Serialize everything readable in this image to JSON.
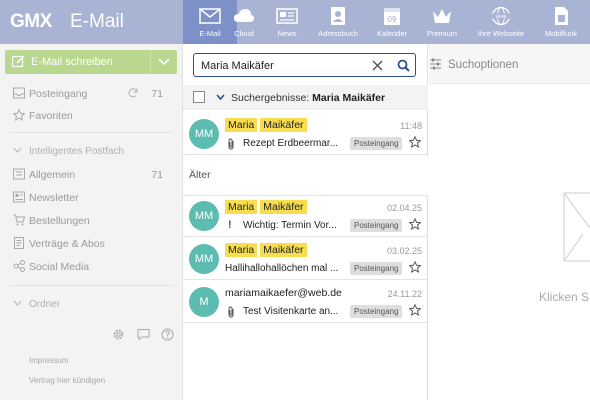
{
  "header": {
    "logo": "GMX",
    "title": "E-Mail",
    "tabs": [
      {
        "label": "E-Mail",
        "icon": "mail-icon"
      },
      {
        "label": "Cloud",
        "icon": "cloud-icon"
      },
      {
        "label": "News",
        "icon": "news-icon"
      },
      {
        "label": "Adressbuch",
        "icon": "addressbook-icon"
      },
      {
        "label": "Kalender",
        "icon": "calendar-icon"
      },
      {
        "label": "Premium",
        "icon": "crown-icon"
      },
      {
        "label": "Ihre Webseite",
        "icon": "globe-icon"
      },
      {
        "label": "Mobilfunk",
        "icon": "sim-icon"
      }
    ],
    "calendar_day": "09",
    "www_text": "www"
  },
  "sidebar": {
    "compose_label": "E-Mail schreiben",
    "inbox": {
      "label": "Posteingang",
      "count": "71"
    },
    "favorites": {
      "label": "Favoriten"
    },
    "smart_header": "Intelligentes Postfach",
    "smart_items": [
      {
        "label": "Allgemein",
        "count": "71",
        "icon": "inbox-icon"
      },
      {
        "label": "Newsletter",
        "icon": "newsletter-icon"
      },
      {
        "label": "Bestellungen",
        "icon": "cart-icon"
      },
      {
        "label": "Verträge & Abos",
        "icon": "contract-icon"
      },
      {
        "label": "Social Media",
        "icon": "social-icon"
      }
    ],
    "folders_header": "Ordner",
    "footer_links": [
      "Impressum",
      "Vertrag hier kündigen"
    ]
  },
  "search": {
    "value": "Maria Maikäfer"
  },
  "results": {
    "prefix": "Suchergebnisse:",
    "query": "Maria Maikäfer"
  },
  "mails": [
    {
      "avatar": "MM",
      "from_hl": [
        "Maria",
        "Maikäfer"
      ],
      "from_text": "",
      "date": "11:48",
      "indicator": "paperclip",
      "subject": "Rezept Erdbeermar...",
      "folder": "Posteingang"
    },
    {
      "avatar": "MM",
      "from_hl": [
        "Maria",
        "Maikäfer"
      ],
      "from_text": "",
      "date": "02.04.25",
      "indicator": "!",
      "subject": "Wichtig: Termin Vor...",
      "folder": "Posteingang"
    },
    {
      "avatar": "MM",
      "from_hl": [
        "Maria",
        "Maikäfer"
      ],
      "from_text": "",
      "date": "03.02.25",
      "indicator": "",
      "subject": "Hallihallohallöchen mal ...",
      "folder": "Posteingang"
    },
    {
      "avatar": "M",
      "from_hl": [],
      "from_text": "mariamaikaefer@web.de",
      "date": "24.11.22",
      "indicator": "paperclip",
      "subject": "Test Visitenkarte an...",
      "folder": "Posteingang"
    }
  ],
  "older_label": "Älter",
  "right": {
    "options_label": "Suchoptionen",
    "click_hint": "Klicken S"
  },
  "colors": {
    "header_bg": "#a9b4d4",
    "active_tab": "#7e90c8",
    "compose_bg": "#b9d78e",
    "avatar_bg": "#5cbcb0",
    "highlight": "#f7dd4f"
  }
}
